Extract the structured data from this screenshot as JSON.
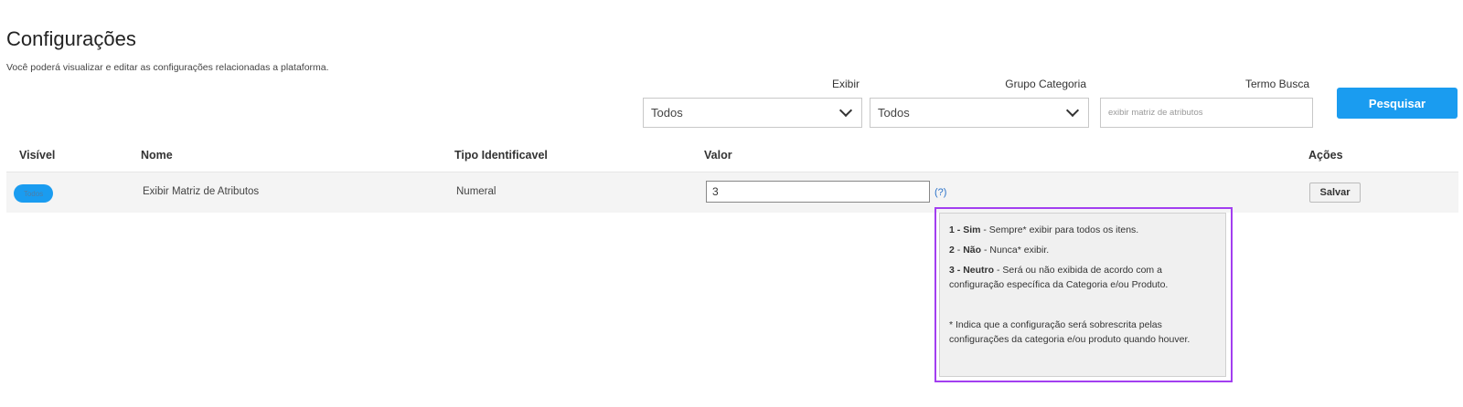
{
  "page": {
    "title": "Configurações",
    "subtitle": "Você poderá visualizar e editar as configurações relacionadas a plataforma."
  },
  "filters": {
    "exibir_label": "Exibir",
    "exibir_value": "Todos",
    "grupo_label": "Grupo Categoria",
    "grupo_value": "Todos",
    "termo_label": "Termo Busca",
    "termo_value": "exibir matriz de atributos",
    "search_button": "Pesquisar"
  },
  "table": {
    "headers": [
      "Visível",
      "Nome",
      "Tipo Identificavel",
      "Valor",
      "Ações"
    ],
    "rows": [
      {
        "visible_toggle": "Todos",
        "name": "Exibir Matriz de Atributos",
        "type": "Numeral",
        "value": "3",
        "help": "(?)",
        "save_label": "Salvar"
      }
    ]
  },
  "tooltip": {
    "item1_num": "1",
    "item1_label": "Sim",
    "item1_text": "Sempre* exibir para todos os itens.",
    "item2_num": "2",
    "item2_label": "Não",
    "item2_text": "Nunca* exibir.",
    "item3_num": "3",
    "item3_label": "Neutro",
    "item3_text": "Será ou não exibida de acordo com a configuração específica da Categoria e/ou Produto.",
    "note": "* Indica que a configuração será sobrescrita pelas configurações da categoria e/ou produto quando houver.",
    "separator": " - "
  },
  "colors": {
    "accent": "#1a9cf0",
    "highlight": "#a23ef0",
    "link": "#2b72c9"
  },
  "icons": {
    "select_arrow": "chevron-down-icon"
  }
}
